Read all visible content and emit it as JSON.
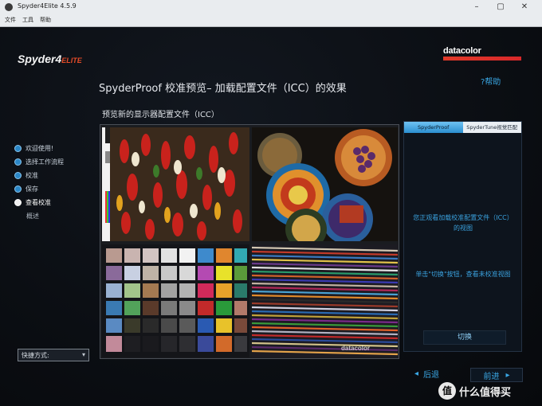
{
  "window": {
    "title": "Spyder4Elite 4.5.9",
    "menu": [
      "文件",
      "工具",
      "帮助"
    ]
  },
  "brand": {
    "left_main": "Spyder4",
    "left_sub": "ELITE",
    "right": "datacolor"
  },
  "header": {
    "title": "SpyderProof 校准预览– 加载配置文件（ICC）的效果",
    "help": "?帮助"
  },
  "preview": {
    "heading": "预览新的显示器配置文件（ICC）",
    "watermark": "datacolor"
  },
  "sidebar": {
    "items": [
      {
        "label": "欢迎使用!",
        "state": "done"
      },
      {
        "label": "选择工作流程",
        "state": "done"
      },
      {
        "label": "校准",
        "state": "done"
      },
      {
        "label": "保存",
        "state": "done"
      },
      {
        "label": "查看校准",
        "state": "active"
      },
      {
        "label": "概述",
        "state": "sub"
      }
    ],
    "shortcut_label": "快捷方式:"
  },
  "rightpanel": {
    "tab_active": "SpyderProof",
    "tab_inactive": "SpyderTune视觉匹配",
    "info1": "您正观看加载校准配置文件（ICC）的视图",
    "info2": "单击\"切换\"按钮，查看未校准视图",
    "switch_label": "切换"
  },
  "nav": {
    "back": "后退",
    "next": "前进",
    "back_icon": "◂",
    "next_icon": "▸"
  },
  "site_watermark": {
    "logo": "值",
    "text": "什么值得买"
  }
}
